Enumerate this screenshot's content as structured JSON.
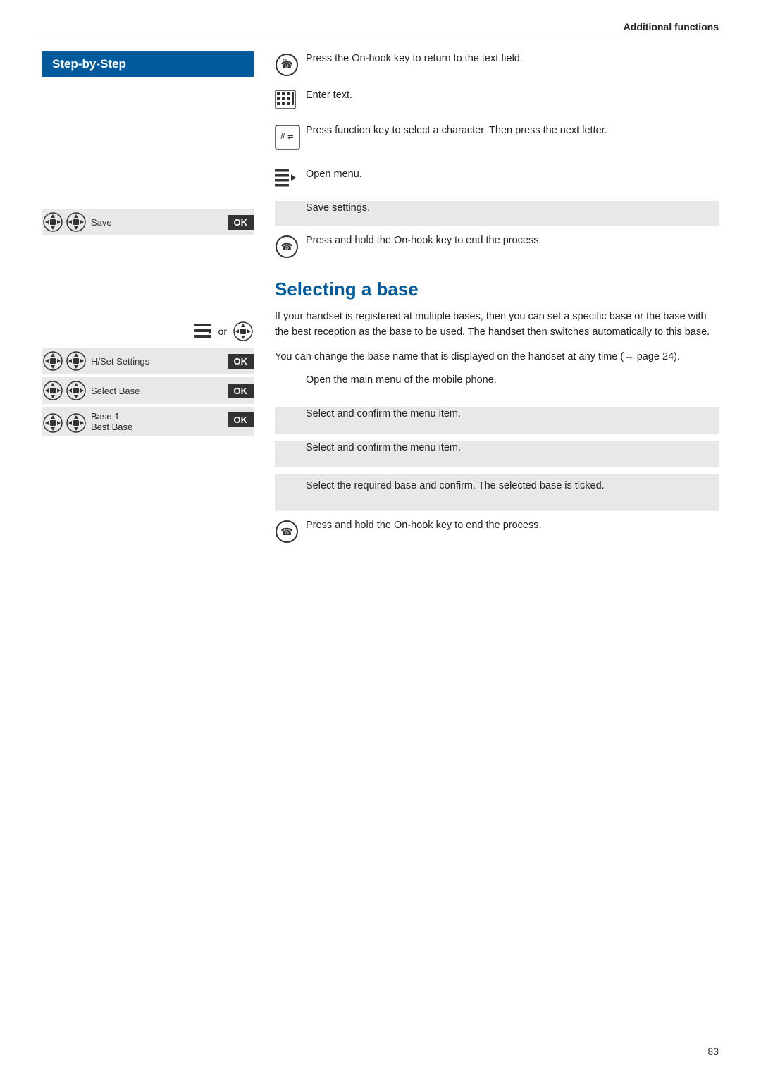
{
  "header": {
    "title": "Additional functions"
  },
  "sidebar": {
    "step_by_step_label": "Step-by-Step"
  },
  "section1": {
    "rows": [
      {
        "id": "onhook1",
        "icon_type": "onhook",
        "text": "Press the On-hook key to return to the text field."
      },
      {
        "id": "keyboard",
        "icon_type": "keyboard",
        "text": "Enter text."
      },
      {
        "id": "funckey",
        "icon_type": "funckey",
        "text": "Press function key to select a character. Then press the next letter."
      },
      {
        "id": "menu",
        "icon_type": "menu",
        "text": "Open menu."
      },
      {
        "id": "save",
        "icon_type": "navok",
        "sidebar_label": "Save",
        "ok": true,
        "text": "Save settings."
      },
      {
        "id": "onhook2",
        "icon_type": "onhook",
        "text": "Press and hold the On-hook key to end the process."
      }
    ]
  },
  "section2": {
    "heading": "Selecting a base",
    "description1": "If your handset is registered at multiple bases, then you can set a specific base or the base with the best reception as the base to be used. The handset then switches automatically to this base.",
    "description2": "You can change the base name that is displayed on the handset at any time (→ page 24).",
    "or_label": "or",
    "rows": [
      {
        "id": "open-menu",
        "icon_type": "menu-or-nav",
        "text": "Open the main menu of the mobile phone."
      },
      {
        "id": "hset",
        "icon_type": "navok",
        "sidebar_label": "H/Set Settings",
        "ok": true,
        "text": "Select and confirm the menu item."
      },
      {
        "id": "selbase",
        "icon_type": "navok",
        "sidebar_label": "Select Base",
        "ok": true,
        "text": "Select and confirm the menu item."
      },
      {
        "id": "base1",
        "icon_type": "navok",
        "sidebar_label": "Base 1",
        "sidebar_label2": "Best Base",
        "ok": true,
        "text": "Select the required base and confirm. The selected base is ticked."
      },
      {
        "id": "onhook3",
        "icon_type": "onhook",
        "text": "Press and hold the On-hook key to end the process."
      }
    ]
  },
  "page_number": "83"
}
